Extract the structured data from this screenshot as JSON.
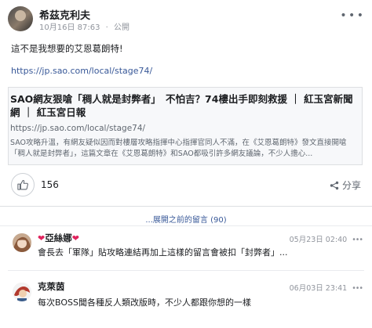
{
  "post": {
    "author": "希茲克利夫",
    "date": "10月16日 87:63",
    "separator": "·",
    "visibility": "公開",
    "text": "這不是我想要的艾恩葛朗特!",
    "link": "https://jp.sao.com/local/stage74/"
  },
  "card": {
    "title": "SAO網友狠嗆「稠人就是封弊者」　不怕吉？74樓出手即刻救援 ｜ 紅玉宮新聞網 ｜ 紅玉宮日報",
    "url": "https://jp.sao.com/local/stage74/",
    "description": "SAO攻略升溫，有網友疑似因而對樓層攻略指揮中心指揮官同人不滿，在《艾恩葛朗特》發文直接開嗆「稠人就是封弊者」，這篇文章在《艾恩葛朗特》和SAO都吸引許多網友議論，不少人擔心..."
  },
  "actions": {
    "like_count": "156",
    "share_label": "分享"
  },
  "prev_comments_label": "...展開之前的留言 (90)",
  "comments": [
    {
      "name": "亞絲娜",
      "time": "05月23日 02:40",
      "body": "會長去「軍隊」貼攻略連結再加上這樣的留言會被扣「封弊者」..."
    },
    {
      "name": "克萊茵",
      "time": "06月03日 23:41",
      "body": "每次BOSS聞各種反人類改版時，不少人都跟你想的一樣"
    }
  ],
  "colors": {
    "link": "#385898",
    "heart": "#e0245e",
    "muted": "#90949c"
  }
}
